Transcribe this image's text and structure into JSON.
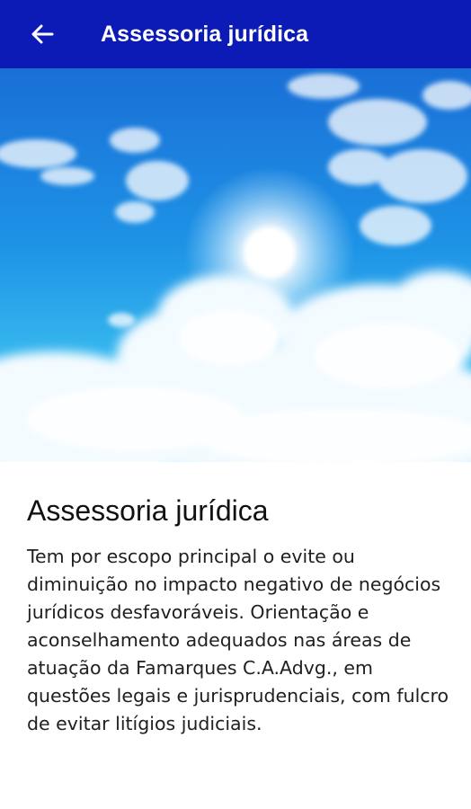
{
  "app_bar": {
    "back_icon": "arrow-back-icon",
    "title": "Assessoria jurídica",
    "background": "#0c1bb5"
  },
  "hero": {
    "description_icon": "sky-sun-clouds-image"
  },
  "content": {
    "title": "Assessoria jurídica",
    "body": "Tem por escopo principal o evite ou diminuição no impacto negativo de negócios jurídicos desfavoráveis. Orientação e aconselhamento adequados nas áreas de atuação da Famarques C.A.Advg., em questões legais e jurisprudenciais, com fulcro de evitar litígios judiciais."
  }
}
